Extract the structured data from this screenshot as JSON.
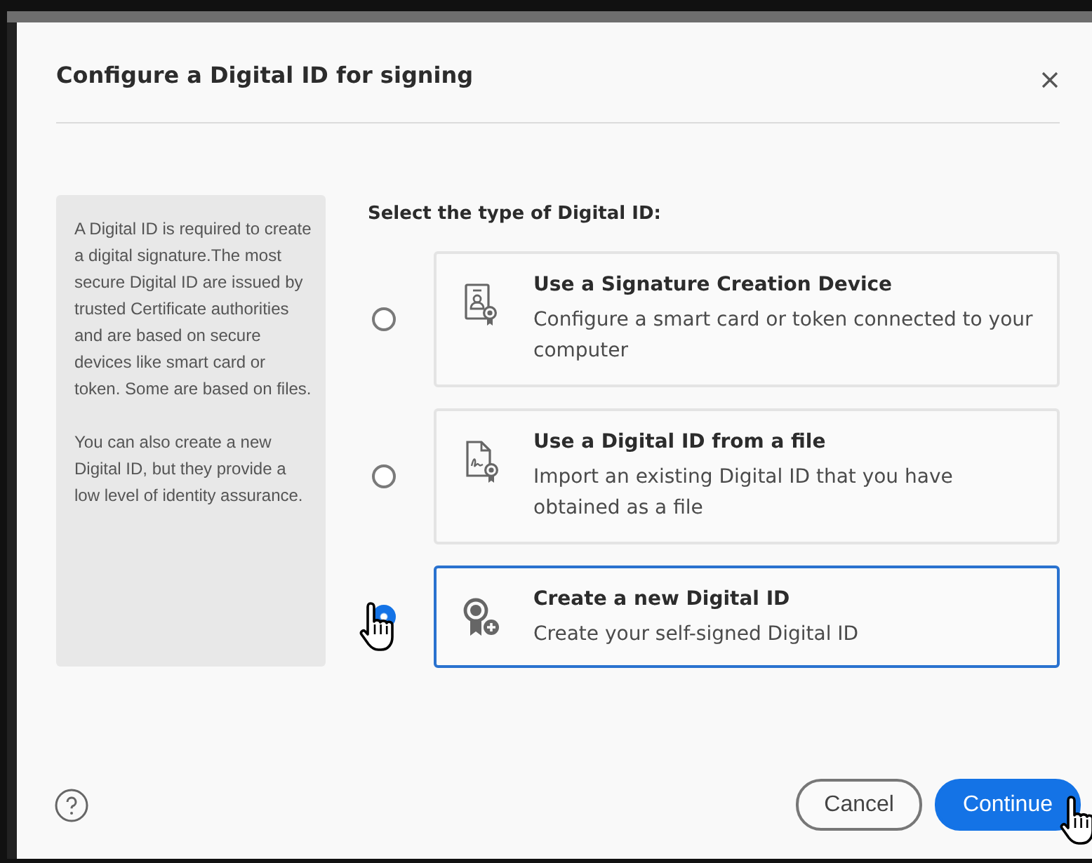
{
  "dialog": {
    "title": "Configure a Digital ID for signing",
    "info": [
      "A Digital ID is required to create a digital signature.The most secure Digital ID are issued by trusted Certificate authorities and are based on secure devices like smart card or token. Some are based on files.",
      "You can also create a new Digital ID, but they provide a low level of identity assurance."
    ],
    "prompt": "Select the type of Digital ID:",
    "options": [
      {
        "kind": "device",
        "title": "Use a Signature Creation Device",
        "description": "Configure a smart card or token connected to your computer",
        "selected": false
      },
      {
        "kind": "file",
        "title": "Use a Digital ID from a file",
        "description": "Import an existing Digital ID that you have obtained as a file",
        "selected": false
      },
      {
        "kind": "new",
        "title": "Create a new Digital ID",
        "description": "Create your self-signed Digital ID",
        "selected": true
      }
    ],
    "buttons": [
      {
        "kind": "secondary",
        "label": "Cancel"
      },
      {
        "kind": "primary",
        "label": "Continue"
      }
    ]
  }
}
